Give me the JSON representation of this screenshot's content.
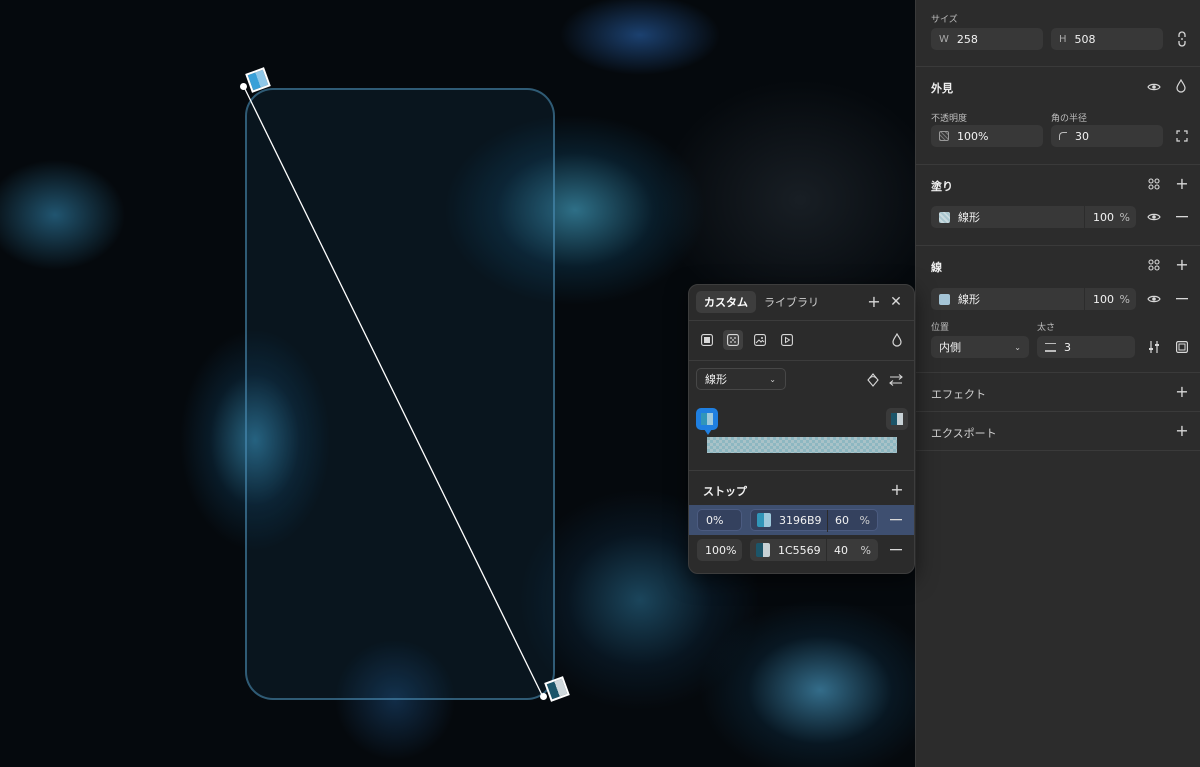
{
  "canvas": {
    "gradient_start_color": "#3196B9",
    "gradient_end_color": "#1C5569"
  },
  "panel": {
    "size": {
      "title": "サイズ",
      "w_prefix": "W",
      "w_value": "258",
      "h_prefix": "H",
      "h_value": "508"
    },
    "appearance": {
      "title": "外見",
      "opacity_label": "不透明度",
      "opacity_value": "100%",
      "radius_label": "角の半径",
      "radius_value": "30"
    },
    "fill": {
      "title": "塗り",
      "type": "線形",
      "opacity": "100",
      "unit": "%"
    },
    "stroke": {
      "title": "線",
      "type": "線形",
      "opacity": "100",
      "unit": "%",
      "position_label": "位置",
      "position_value": "内側",
      "weight_label": "太さ",
      "weight_value": "3"
    },
    "effects": {
      "title": "エフェクト"
    },
    "export": {
      "title": "エクスポート"
    }
  },
  "popup": {
    "tabs": [
      {
        "label": "カスタム",
        "active": true
      },
      {
        "label": "ライブラリ",
        "active": false
      }
    ],
    "type_select": "線形",
    "stops_title": "ストップ",
    "stops": [
      {
        "position": "0%",
        "color": "3196B9",
        "swatch": "#3196B9",
        "opacity": "60",
        "unit": "%",
        "selected": true
      },
      {
        "position": "100%",
        "color": "1C5569",
        "swatch": "#1C5569",
        "opacity": "40",
        "unit": "%",
        "selected": false
      }
    ]
  }
}
